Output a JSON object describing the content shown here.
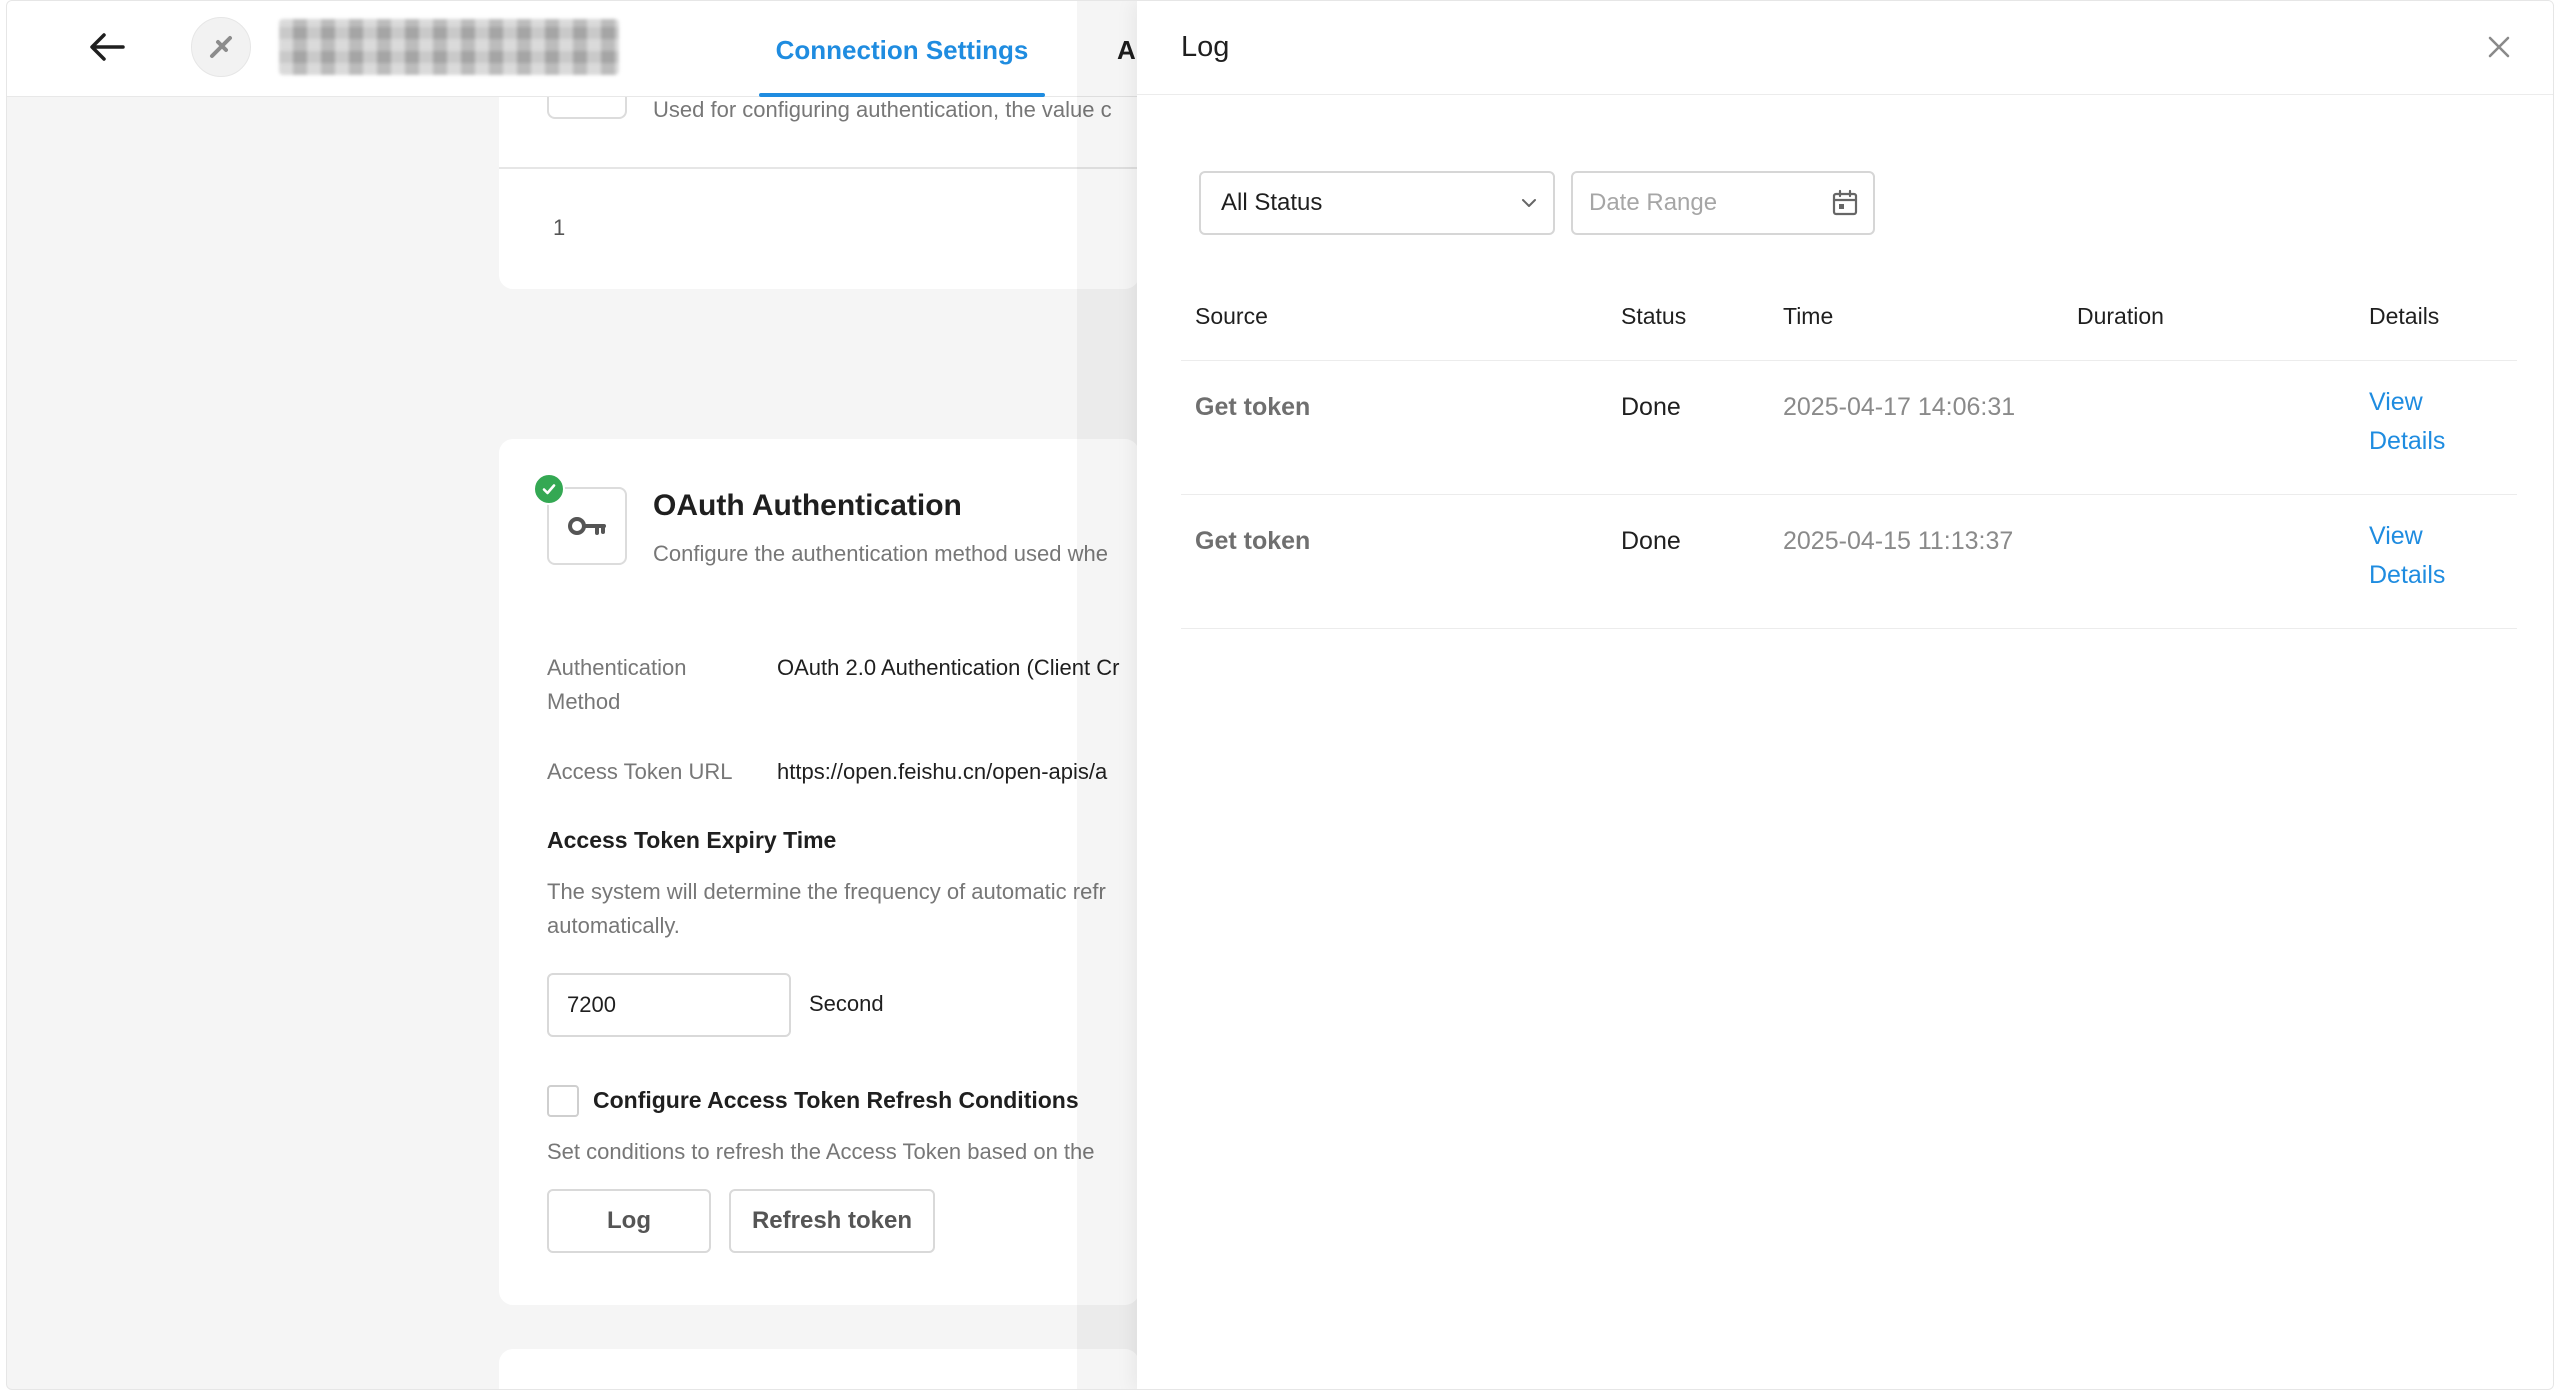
{
  "header": {
    "active_tab": "Connection Settings",
    "next_tab_partial": "A"
  },
  "top_card": {
    "description": "Used for configuring authentication, the value c",
    "page_number": "1"
  },
  "oauth": {
    "title": "OAuth Authentication",
    "description": "Configure the authentication method used whe",
    "method_label": "Authentication Method",
    "method_value": "OAuth 2.0 Authentication (Client Cr",
    "url_label": "Access Token URL",
    "url_value": "https://open.feishu.cn/open-apis/a",
    "expiry_title": "Access Token Expiry Time",
    "expiry_desc": "The system will determine the frequency of automatic refr automatically.",
    "expiry_value": "7200",
    "expiry_unit": "Second",
    "refresh_checkbox_label": "Configure Access Token Refresh Conditions",
    "refresh_desc": "Set conditions to refresh the Access Token based on the ",
    "log_button": "Log",
    "refresh_button": "Refresh token"
  },
  "log_panel": {
    "title": "Log",
    "status_filter": "All Status",
    "date_placeholder": "Date Range",
    "columns": {
      "source": "Source",
      "status": "Status",
      "time": "Time",
      "duration": "Duration",
      "details": "Details"
    },
    "rows": [
      {
        "source": "Get token",
        "status": "Done",
        "time": "2025-04-17 14:06:31",
        "duration": "",
        "details": "View Details"
      },
      {
        "source": "Get token",
        "status": "Done",
        "time": "2025-04-15 11:13:37",
        "duration": "",
        "details": "View Details"
      }
    ]
  },
  "colors": {
    "accent": "#1f8ce0",
    "success": "#34a853"
  }
}
